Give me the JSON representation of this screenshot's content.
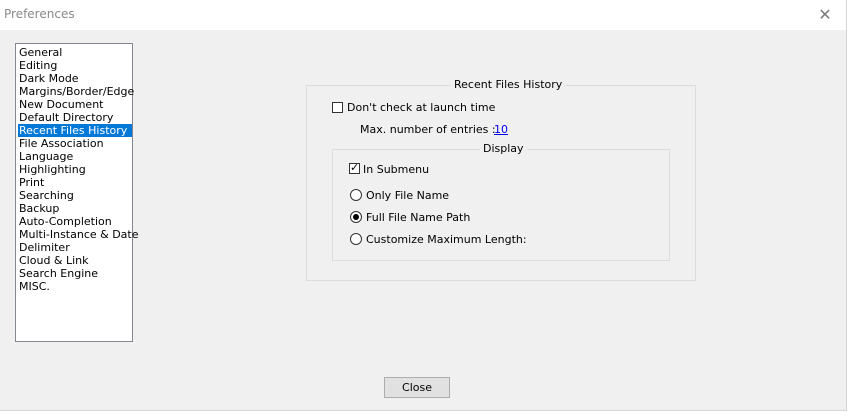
{
  "window": {
    "title": "Preferences"
  },
  "sidebar": {
    "items": [
      {
        "label": "General"
      },
      {
        "label": "Editing"
      },
      {
        "label": "Dark Mode"
      },
      {
        "label": "Margins/Border/Edge"
      },
      {
        "label": "New Document"
      },
      {
        "label": "Default Directory"
      },
      {
        "label": "Recent Files History",
        "selected": true
      },
      {
        "label": "File Association"
      },
      {
        "label": "Language"
      },
      {
        "label": "Highlighting"
      },
      {
        "label": "Print"
      },
      {
        "label": "Searching"
      },
      {
        "label": "Backup"
      },
      {
        "label": "Auto-Completion"
      },
      {
        "label": "Multi-Instance & Date"
      },
      {
        "label": "Delimiter"
      },
      {
        "label": "Cloud & Link"
      },
      {
        "label": "Search Engine"
      },
      {
        "label": "MISC."
      }
    ]
  },
  "recent_files": {
    "group_title": "Recent Files History",
    "dont_check_label": "Don't check at launch time",
    "dont_check_checked": false,
    "max_entries_label": "Max. number of entries :",
    "max_entries_value": "10",
    "display": {
      "group_title": "Display",
      "in_submenu_label": "In Submenu",
      "in_submenu_checked": true,
      "options": [
        {
          "label": "Only File Name",
          "selected": false
        },
        {
          "label": "Full File Name Path",
          "selected": true
        },
        {
          "label": "Customize Maximum Length:",
          "selected": false
        }
      ]
    }
  },
  "footer": {
    "close_label": "Close"
  },
  "colors": {
    "selection": "#0078d7",
    "link": "#0000ee",
    "dialog_bg": "#f0f0f0"
  }
}
